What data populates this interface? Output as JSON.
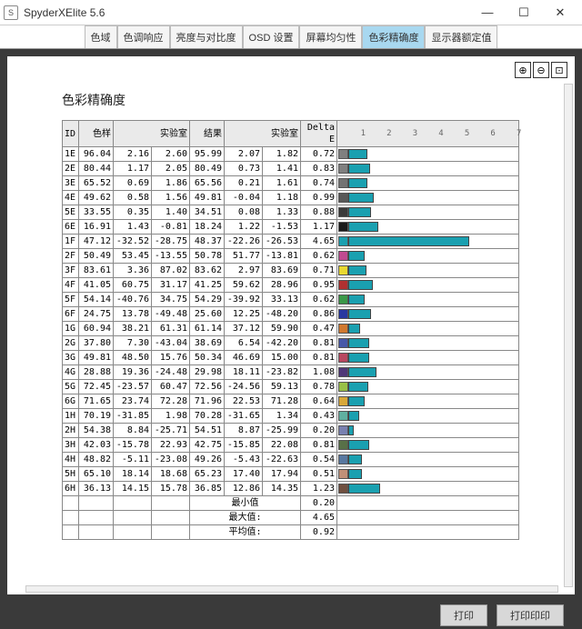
{
  "window": {
    "icon_letter": "S",
    "title": "SpyderXElite 5.6"
  },
  "tabs": [
    "色域",
    "色调响应",
    "亮度与对比度",
    "OSD 设置",
    "屏幕均匀性",
    "色彩精确度",
    "显示器额定值"
  ],
  "active_tab_index": 5,
  "zoom": {
    "in": "⊕",
    "out": "⊖",
    "fit": "⊡"
  },
  "heading": "色彩精确度",
  "headers": {
    "id": "ID",
    "sample": "色样",
    "lab1": "实验室",
    "result": "结果",
    "lab2": "实验室",
    "delta": "Delta E"
  },
  "bar_ticks": [
    1,
    2,
    3,
    4,
    5,
    6,
    7
  ],
  "rows": [
    {
      "id": "1E",
      "s1": "96.04",
      "s2": "2.16",
      "s3": "2.60",
      "r1": "95.99",
      "r2": "2.07",
      "r3": "1.82",
      "de": "0.72",
      "sw": "#808080",
      "bar": 0.72
    },
    {
      "id": "2E",
      "s1": "80.44",
      "s2": "1.17",
      "s3": "2.05",
      "r1": "80.49",
      "r2": "0.73",
      "r3": "1.41",
      "de": "0.83",
      "sw": "#808080",
      "bar": 0.83
    },
    {
      "id": "3E",
      "s1": "65.52",
      "s2": "0.69",
      "s3": "1.86",
      "r1": "65.56",
      "r2": "0.21",
      "r3": "1.61",
      "de": "0.74",
      "sw": "#737373",
      "bar": 0.74
    },
    {
      "id": "4E",
      "s1": "49.62",
      "s2": "0.58",
      "s3": "1.56",
      "r1": "49.81",
      "r2": "-0.04",
      "r3": "1.18",
      "de": "0.99",
      "sw": "#595959",
      "bar": 0.99
    },
    {
      "id": "5E",
      "s1": "33.55",
      "s2": "0.35",
      "s3": "1.40",
      "r1": "34.51",
      "r2": "0.08",
      "r3": "1.33",
      "de": "0.88",
      "sw": "#3a3a3a",
      "bar": 0.88
    },
    {
      "id": "6E",
      "s1": "16.91",
      "s2": "1.43",
      "s3": "-0.81",
      "r1": "18.24",
      "r2": "1.22",
      "r3": "-1.53",
      "de": "1.17",
      "sw": "#1a1a1a",
      "bar": 1.17
    },
    {
      "id": "1F",
      "s1": "47.12",
      "s2": "-32.52",
      "s3": "-28.75",
      "r1": "48.37",
      "r2": "-22.26",
      "r3": "-26.53",
      "de": "4.65",
      "sw": "#1aa0b0",
      "bar": 4.65
    },
    {
      "id": "2F",
      "s1": "50.49",
      "s2": "53.45",
      "s3": "-13.55",
      "r1": "50.78",
      "r2": "51.77",
      "r3": "-13.81",
      "de": "0.62",
      "sw": "#c04a90",
      "bar": 0.62
    },
    {
      "id": "3F",
      "s1": "83.61",
      "s2": "3.36",
      "s3": "87.02",
      "r1": "83.62",
      "r2": "2.97",
      "r3": "83.69",
      "de": "0.71",
      "sw": "#e8d830",
      "bar": 0.71
    },
    {
      "id": "4F",
      "s1": "41.05",
      "s2": "60.75",
      "s3": "31.17",
      "r1": "41.25",
      "r2": "59.62",
      "r3": "28.96",
      "de": "0.95",
      "sw": "#b03030",
      "bar": 0.95
    },
    {
      "id": "5F",
      "s1": "54.14",
      "s2": "-40.76",
      "s3": "34.75",
      "r1": "54.29",
      "r2": "-39.92",
      "r3": "33.13",
      "de": "0.62",
      "sw": "#3a9848",
      "bar": 0.62
    },
    {
      "id": "6F",
      "s1": "24.75",
      "s2": "13.78",
      "s3": "-49.48",
      "r1": "25.60",
      "r2": "12.25",
      "r3": "-48.20",
      "de": "0.86",
      "sw": "#2838a0",
      "bar": 0.86
    },
    {
      "id": "1G",
      "s1": "60.94",
      "s2": "38.21",
      "s3": "61.31",
      "r1": "61.14",
      "r2": "37.12",
      "r3": "59.90",
      "de": "0.47",
      "sw": "#d07830",
      "bar": 0.47
    },
    {
      "id": "2G",
      "s1": "37.80",
      "s2": "7.30",
      "s3": "-43.04",
      "r1": "38.69",
      "r2": "6.54",
      "r3": "-42.20",
      "de": "0.81",
      "sw": "#4858a8",
      "bar": 0.81
    },
    {
      "id": "3G",
      "s1": "49.81",
      "s2": "48.50",
      "s3": "15.76",
      "r1": "50.34",
      "r2": "46.69",
      "r3": "15.00",
      "de": "0.81",
      "sw": "#b84860",
      "bar": 0.81
    },
    {
      "id": "4G",
      "s1": "28.88",
      "s2": "19.36",
      "s3": "-24.48",
      "r1": "29.98",
      "r2": "18.11",
      "r3": "-23.82",
      "de": "1.08",
      "sw": "#503878",
      "bar": 1.08
    },
    {
      "id": "5G",
      "s1": "72.45",
      "s2": "-23.57",
      "s3": "60.47",
      "r1": "72.56",
      "r2": "-24.56",
      "r3": "59.13",
      "de": "0.78",
      "sw": "#98c048",
      "bar": 0.78
    },
    {
      "id": "6G",
      "s1": "71.65",
      "s2": "23.74",
      "s3": "72.28",
      "r1": "71.96",
      "r2": "22.53",
      "r3": "71.28",
      "de": "0.64",
      "sw": "#d8a838",
      "bar": 0.64
    },
    {
      "id": "1H",
      "s1": "70.19",
      "s2": "-31.85",
      "s3": "1.98",
      "r1": "70.28",
      "r2": "-31.65",
      "r3": "1.34",
      "de": "0.43",
      "sw": "#60b0a0",
      "bar": 0.43
    },
    {
      "id": "2H",
      "s1": "54.38",
      "s2": "8.84",
      "s3": "-25.71",
      "r1": "54.51",
      "r2": "8.87",
      "r3": "-25.99",
      "de": "0.20",
      "sw": "#7880b0",
      "bar": 0.2
    },
    {
      "id": "3H",
      "s1": "42.03",
      "s2": "-15.78",
      "s3": "22.93",
      "r1": "42.75",
      "r2": "-15.85",
      "r3": "22.08",
      "de": "0.81",
      "sw": "#587048",
      "bar": 0.81
    },
    {
      "id": "4H",
      "s1": "48.82",
      "s2": "-5.11",
      "s3": "-23.08",
      "r1": "49.26",
      "r2": "-5.43",
      "r3": "-22.63",
      "de": "0.54",
      "sw": "#5878a0",
      "bar": 0.54
    },
    {
      "id": "5H",
      "s1": "65.10",
      "s2": "18.14",
      "s3": "18.68",
      "r1": "65.23",
      "r2": "17.40",
      "r3": "17.94",
      "de": "0.51",
      "sw": "#c09078",
      "bar": 0.51
    },
    {
      "id": "6H",
      "s1": "36.13",
      "s2": "14.15",
      "s3": "15.78",
      "r1": "36.85",
      "r2": "12.86",
      "r3": "14.35",
      "de": "1.23",
      "sw": "#705040",
      "bar": 1.23
    }
  ],
  "summary": {
    "min_label": "最小值",
    "min": "0.20",
    "max_label": "最大值:",
    "max": "4.65",
    "avg_label": "平均值:",
    "avg": "0.92"
  },
  "footer": {
    "print": "打印",
    "print2": "打印印印"
  },
  "chart_data": {
    "type": "bar",
    "title": "色彩精确度 Delta E",
    "xlabel": "Delta E",
    "ylabel": "色样 ID",
    "xlim": [
      0,
      7
    ],
    "categories": [
      "1E",
      "2E",
      "3E",
      "4E",
      "5E",
      "6E",
      "1F",
      "2F",
      "3F",
      "4F",
      "5F",
      "6F",
      "1G",
      "2G",
      "3G",
      "4G",
      "5G",
      "6G",
      "1H",
      "2H",
      "3H",
      "4H",
      "5H",
      "6H"
    ],
    "values": [
      0.72,
      0.83,
      0.74,
      0.99,
      0.88,
      1.17,
      4.65,
      0.62,
      0.71,
      0.95,
      0.62,
      0.86,
      0.47,
      0.81,
      0.81,
      1.08,
      0.78,
      0.64,
      0.43,
      0.2,
      0.81,
      0.54,
      0.51,
      1.23
    ]
  }
}
